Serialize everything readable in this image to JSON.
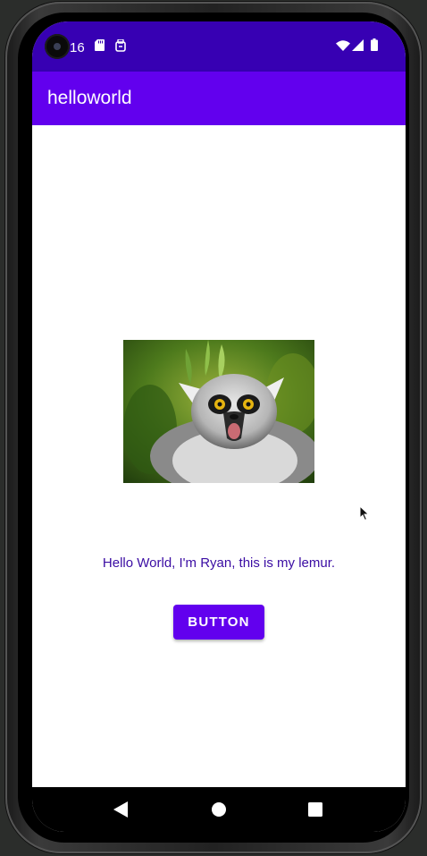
{
  "status_bar": {
    "time": "16",
    "icons": [
      "camera-hole",
      "sd-card-icon",
      "sim-icon",
      "wifi-icon",
      "cellular-signal-icon",
      "battery-icon"
    ],
    "color": "#3700b3"
  },
  "app_bar": {
    "title": "helloworld",
    "color": "#6200ee"
  },
  "main": {
    "image_description_icon": "lemur-image",
    "hello_text": "Hello World, I'm Ryan, this is my lemur.",
    "button_label": "BUTTON",
    "text_color": "#3a0ca3",
    "button_color": "#6200ee"
  },
  "nav_bar": {
    "buttons": [
      "back-icon",
      "home-icon",
      "recents-icon"
    ]
  }
}
